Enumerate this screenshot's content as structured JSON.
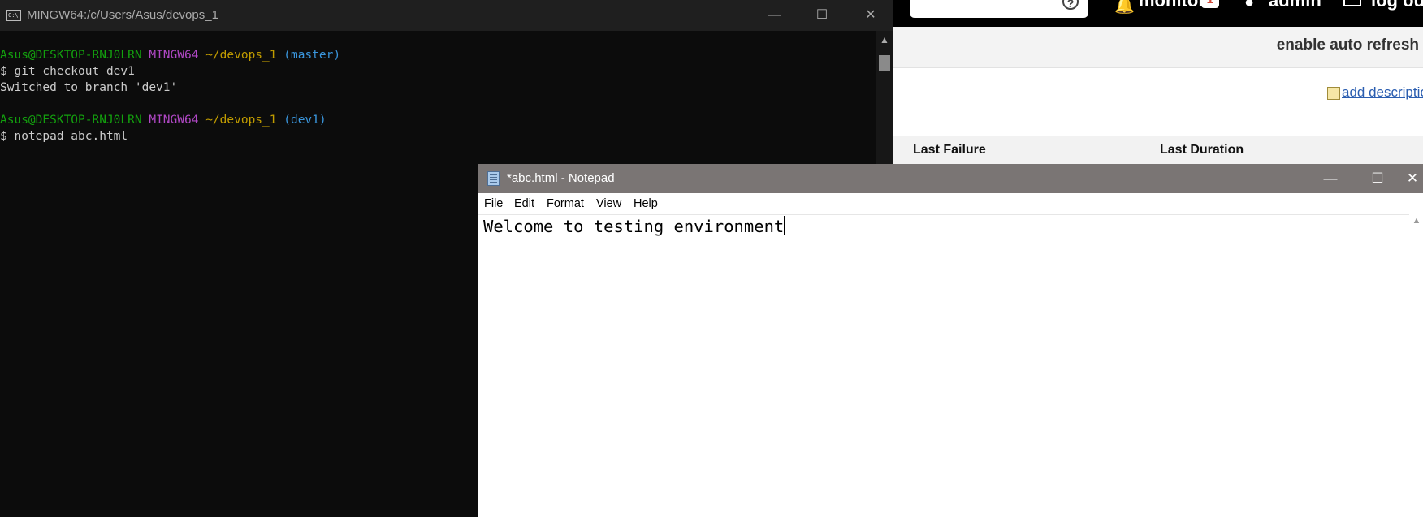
{
  "background_page": {
    "header": {
      "help_icon": "help-circle-icon",
      "bell_icon": "bell-icon",
      "monitor_label": "monitor",
      "monitor_count": "1",
      "user_icon": "user-icon",
      "user_label": "admin",
      "logout_icon": "logout-icon",
      "logout_label": "log out"
    },
    "auto_refresh_link": "enable auto refresh",
    "add_description_link": "add description",
    "table_headers": [
      "Last Failure",
      "Last Duration"
    ]
  },
  "terminal": {
    "title": "MINGW64:/c/Users/Asus/devops_1",
    "icon": "console-icon",
    "lines": [
      {
        "user": "Asus@DESKTOP-RNJ0LRN",
        "shell": "MINGW64",
        "path": "~/devops_1",
        "branch": "(master)"
      },
      {
        "text": "$ git checkout dev1"
      },
      {
        "text": "Switched to branch 'dev1'"
      },
      {
        "text": ""
      },
      {
        "user": "Asus@DESKTOP-RNJ0LRN",
        "shell": "MINGW64",
        "path": "~/devops_1",
        "branch": "(dev1)"
      },
      {
        "text": "$ notepad abc.html"
      }
    ],
    "colors": {
      "user": "#13a10e",
      "shell": "#b148c6",
      "path": "#c19c00",
      "branch": "#3a96dd"
    }
  },
  "notepad": {
    "title": "*abc.html - Notepad",
    "icon": "notepad-icon",
    "menu": [
      "File",
      "Edit",
      "Format",
      "View",
      "Help"
    ],
    "content": "Welcome to testing environment"
  },
  "window_controls": {
    "minimize": "—",
    "maximize": "☐",
    "close": "✕"
  }
}
